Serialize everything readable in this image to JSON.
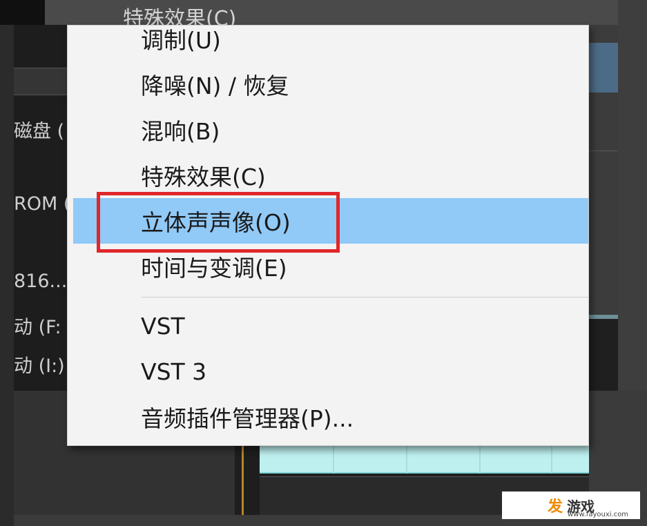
{
  "background": {
    "header_title": "特殊效果(C)",
    "left_labels": [
      "磁盘 (",
      "ROM (",
      "816...",
      "动 (F:",
      "动 (I:)"
    ]
  },
  "menu": {
    "items": [
      {
        "label": "调制(U)",
        "highlighted": false
      },
      {
        "label": "降噪(N) / 恢复",
        "highlighted": false
      },
      {
        "label": "混响(B)",
        "highlighted": false
      },
      {
        "label": "特殊效果(C)",
        "highlighted": false
      },
      {
        "label": "立体声声像(O)",
        "highlighted": true
      },
      {
        "label": "时间与变调(E)",
        "highlighted": false
      },
      {
        "label": "VST",
        "highlighted": false
      },
      {
        "label": "VST 3",
        "highlighted": false
      },
      {
        "label": "音频插件管理器(P)...",
        "highlighted": false
      }
    ],
    "highlight_color": "#91c9f7",
    "annotation_box_color": "#e0262a"
  },
  "watermark": {
    "logo_text": "发",
    "name": "游戏",
    "url": "www.fayouxi.com"
  }
}
